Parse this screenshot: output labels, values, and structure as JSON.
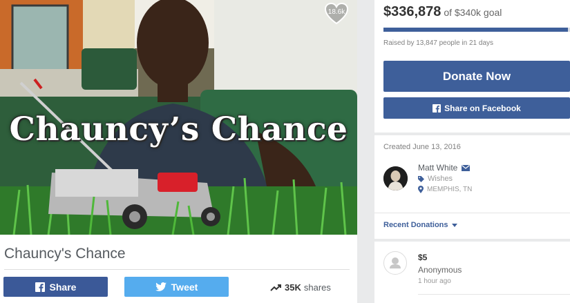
{
  "hero": {
    "title_overlay": "Chauncy’s Chance",
    "heart_count": "18.6k"
  },
  "campaign": {
    "title": "Chauncy's Chance"
  },
  "social": {
    "share_label": "Share",
    "tweet_label": "Tweet",
    "shares_count": "35K",
    "shares_suffix": "shares"
  },
  "funding": {
    "raised": "$336,878",
    "goal_text": "of $340k goal",
    "progress_fraction": 0.99,
    "raised_by_text": "Raised by 13,847 people in 21 days"
  },
  "actions": {
    "donate_label": "Donate Now",
    "facebook_label": "Share on Facebook"
  },
  "organizer": {
    "created": "Created June 13, 2016",
    "name": "Matt White",
    "category": "Wishes",
    "location": "MEMPHIS, TN"
  },
  "recent_donations": {
    "header": "Recent Donations",
    "items": [
      {
        "amount": "$5",
        "name": "Anonymous",
        "time": "1 hour ago"
      }
    ]
  },
  "colors": {
    "brand_blue": "#3e5f9a",
    "facebook_blue": "#3b5998",
    "twitter_blue": "#55acee",
    "progress_track": "#d9dde3"
  },
  "icons": {
    "heart": "heart-icon",
    "facebook": "facebook-icon",
    "twitter": "twitter-icon",
    "trending": "trending-up-icon",
    "envelope": "envelope-icon",
    "tag": "tag-icon",
    "location": "location-pin-icon",
    "caret": "caret-down-icon",
    "user": "user-icon"
  }
}
